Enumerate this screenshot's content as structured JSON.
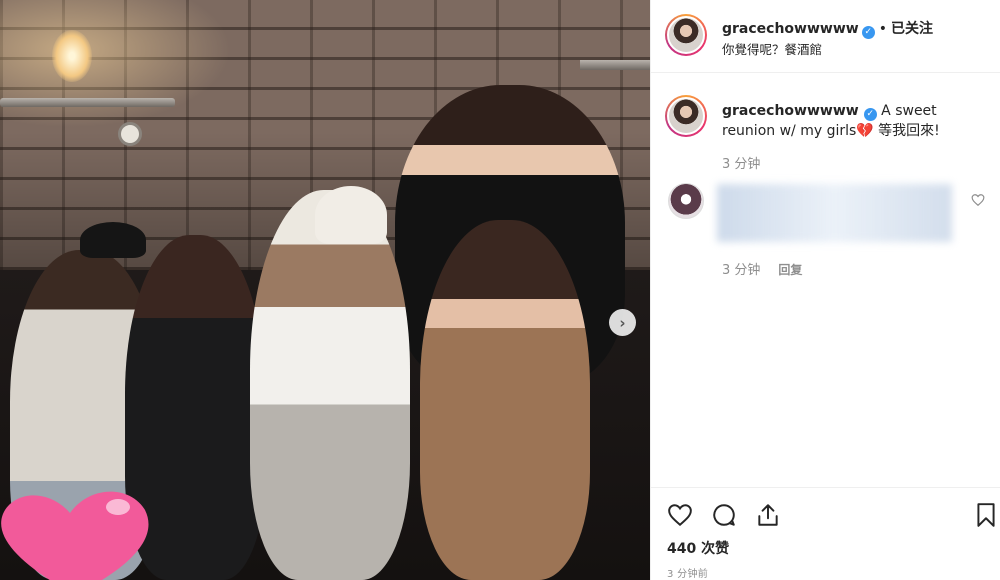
{
  "post": {
    "carousel_next_label": "›"
  },
  "header": {
    "username": "gracechowwwww",
    "verified_label": "✓",
    "separator": "•",
    "follow_status": "已关注",
    "location": "你覺得呢？餐酒館"
  },
  "caption": {
    "username": "gracechowwwww",
    "verified_label": "✓",
    "text_before": "A sweet reunion w/ my girls",
    "emoji": "💔",
    "text_after": " 等我回來!",
    "time": "3 分钟"
  },
  "comments": [
    {
      "time": "3 分钟",
      "reply_label": "回复"
    }
  ],
  "footer": {
    "likes": "440 次赞",
    "timestamp": "3 分钟前"
  },
  "icons": {
    "like": "heart-outline-icon",
    "comment": "speech-bubble-icon",
    "share": "share-upload-icon",
    "save": "bookmark-icon"
  },
  "colors": {
    "verified_blue": "#3897f0",
    "secondary_text": "#8e8e8e",
    "primary_text": "#262626",
    "heart_sticker": "#f25a9a"
  }
}
